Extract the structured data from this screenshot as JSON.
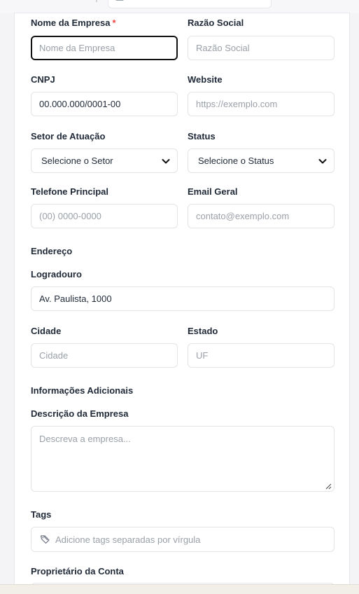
{
  "form": {
    "company_name": {
      "label": "Nome da Empresa",
      "required_mark": "*",
      "placeholder": "Nome da Empresa",
      "value": ""
    },
    "legal_name": {
      "label": "Razão Social",
      "placeholder": "Razão Social",
      "value": ""
    },
    "cnpj": {
      "label": "CNPJ",
      "placeholder": "00.000.000/0001-00",
      "value": "00.000.000/0001-00"
    },
    "website": {
      "label": "Website",
      "placeholder": "https://exemplo.com",
      "value": ""
    },
    "sector": {
      "label": "Setor de Atuação",
      "selected": "Selecione o Setor"
    },
    "status": {
      "label": "Status",
      "selected": "Selecione o Status"
    },
    "phone": {
      "label": "Telefone Principal",
      "placeholder": "(00) 0000-0000",
      "value": ""
    },
    "email": {
      "label": "Email Geral",
      "placeholder": "contato@exemplo.com",
      "value": ""
    },
    "address_section": "Endereço",
    "street": {
      "label": "Logradouro",
      "placeholder": "Av. Paulista, 1000",
      "value": "Av. Paulista, 1000"
    },
    "city": {
      "label": "Cidade",
      "placeholder": "Cidade",
      "value": ""
    },
    "state": {
      "label": "Estado",
      "placeholder": "UF",
      "value": ""
    },
    "additional_section": "Informações Adicionais",
    "description": {
      "label": "Descrição da Empresa",
      "placeholder": "Descreva a empresa..."
    },
    "tags": {
      "label": "Tags",
      "placeholder": "Adicione tags separadas por vírgula",
      "icon": "tag-icon"
    },
    "owner": {
      "label": "Proprietário da Conta"
    }
  },
  "colors": {
    "required": "#ef4444",
    "focus_border": "#111111",
    "input_border": "#e2e4e8",
    "placeholder": "#9aa0a8"
  }
}
